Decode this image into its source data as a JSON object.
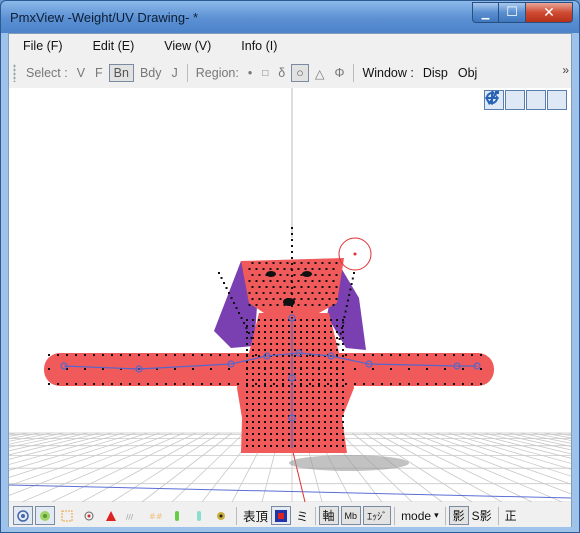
{
  "window": {
    "title": "PmxView -Weight/UV Drawing- *",
    "minimize_glyph": "▁",
    "maximize_glyph": "☐",
    "close_glyph": "✕"
  },
  "menu": [
    {
      "label": "File (F)"
    },
    {
      "label": "Edit (E)"
    },
    {
      "label": "View (V)"
    },
    {
      "label": "Info (I)"
    }
  ],
  "toolbar": {
    "select_label": "Select :",
    "select_items": [
      "V",
      "F",
      "Bn",
      "Bdy",
      "J"
    ],
    "select_pressed": "Bn",
    "region_label": "Region:",
    "region_items": [
      "•",
      "□",
      "δ",
      "○",
      "△",
      "Φ"
    ],
    "region_pressed": "○",
    "window_label": "Window :",
    "window_items": [
      "Disp",
      "Obj"
    ],
    "more_glyph": "»"
  },
  "viewport": {
    "nav_icons": [
      "move-view-icon",
      "pan-icon",
      "zoom-icon",
      "rotate-icon"
    ],
    "colors": {
      "body": "#f05a5a",
      "ears": "#7a3fb0",
      "vertex": "#111111",
      "bone": "#5566cc",
      "cursor": "#e03030",
      "grid": "#c8c8c8"
    }
  },
  "statusbar": {
    "mode_icons": [
      "view-mode-icon",
      "bone-mode-icon",
      "mesh-mode-icon",
      "target-mode-icon",
      "vertex-mode-icon",
      "wire-mode-icon",
      "weight-mode-icon",
      "morph-mode-icon",
      "body-mode-icon",
      "joint-mode-icon"
    ],
    "surface_label": "表頂",
    "mi_label": "ミ",
    "axis_label": "軸",
    "mb_label": "Mb",
    "edge_label": "ｴｯｼﾞ",
    "mode_label": "mode",
    "mode_caret": "▾",
    "shadow_label": "影",
    "sshadow_label": "S影",
    "ortho_label": "正"
  }
}
